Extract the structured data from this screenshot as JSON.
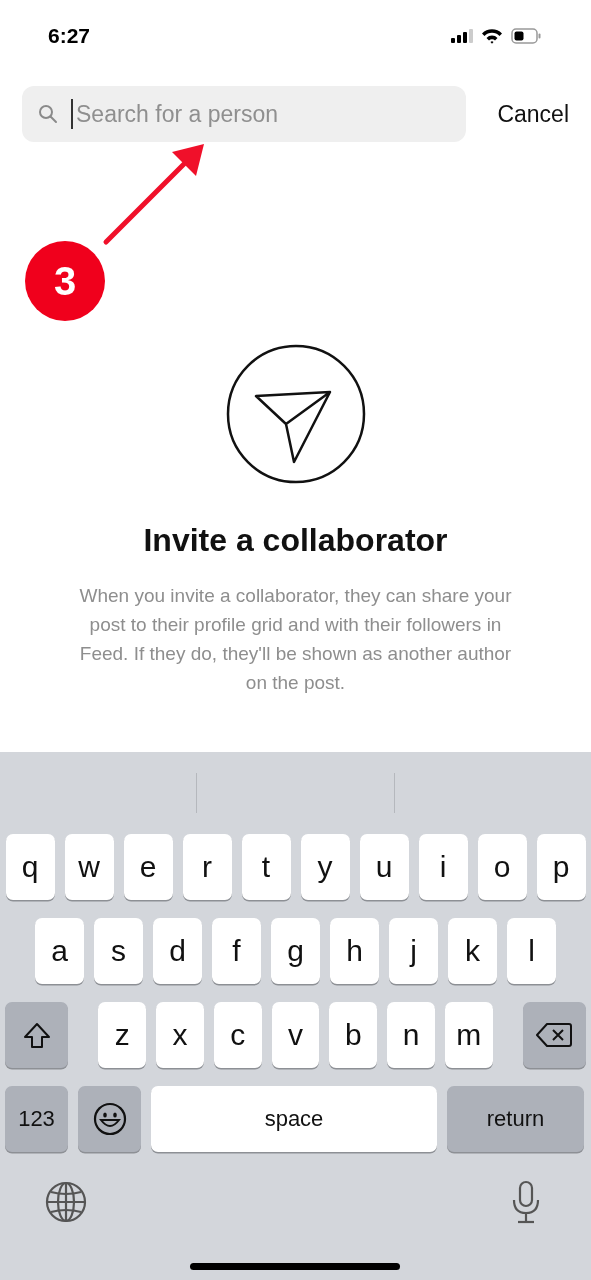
{
  "status_bar": {
    "time": "6:27"
  },
  "search": {
    "placeholder": "Search for a person",
    "focused": true
  },
  "cancel": "Cancel",
  "annotation": {
    "step": "3"
  },
  "invite": {
    "title": "Invite a collaborator",
    "description": "When you invite a collaborator, they can share your post to their profile grid and with their followers in Feed. If they do, they'll be shown as another author on the post."
  },
  "keyboard": {
    "key_rows": [
      {
        "keys": [
          {
            "kind": "letter",
            "label": "q"
          },
          {
            "kind": "letter",
            "label": "w"
          },
          {
            "kind": "letter",
            "label": "e"
          },
          {
            "kind": "letter",
            "label": "r"
          },
          {
            "kind": "letter",
            "label": "t"
          },
          {
            "kind": "letter",
            "label": "y"
          },
          {
            "kind": "letter",
            "label": "u"
          },
          {
            "kind": "letter",
            "label": "i"
          },
          {
            "kind": "letter",
            "label": "o"
          },
          {
            "kind": "letter",
            "label": "p"
          }
        ]
      },
      {
        "keys": [
          {
            "kind": "letter",
            "label": "a"
          },
          {
            "kind": "letter",
            "label": "s"
          },
          {
            "kind": "letter",
            "label": "d"
          },
          {
            "kind": "letter",
            "label": "f"
          },
          {
            "kind": "letter",
            "label": "g"
          },
          {
            "kind": "letter",
            "label": "h"
          },
          {
            "kind": "letter",
            "label": "j"
          },
          {
            "kind": "letter",
            "label": "k"
          },
          {
            "kind": "letter",
            "label": "l"
          }
        ]
      },
      {
        "keys": [
          {
            "kind": "shift"
          },
          {
            "kind": "letter",
            "label": "z"
          },
          {
            "kind": "letter",
            "label": "x"
          },
          {
            "kind": "letter",
            "label": "c"
          },
          {
            "kind": "letter",
            "label": "v"
          },
          {
            "kind": "letter",
            "label": "b"
          },
          {
            "kind": "letter",
            "label": "n"
          },
          {
            "kind": "letter",
            "label": "m"
          },
          {
            "kind": "delete"
          }
        ]
      },
      {
        "keys": [
          {
            "kind": "numbers",
            "label": "123"
          },
          {
            "kind": "emoji"
          },
          {
            "kind": "space",
            "label": "space"
          },
          {
            "kind": "return",
            "label": "return"
          }
        ]
      }
    ]
  }
}
